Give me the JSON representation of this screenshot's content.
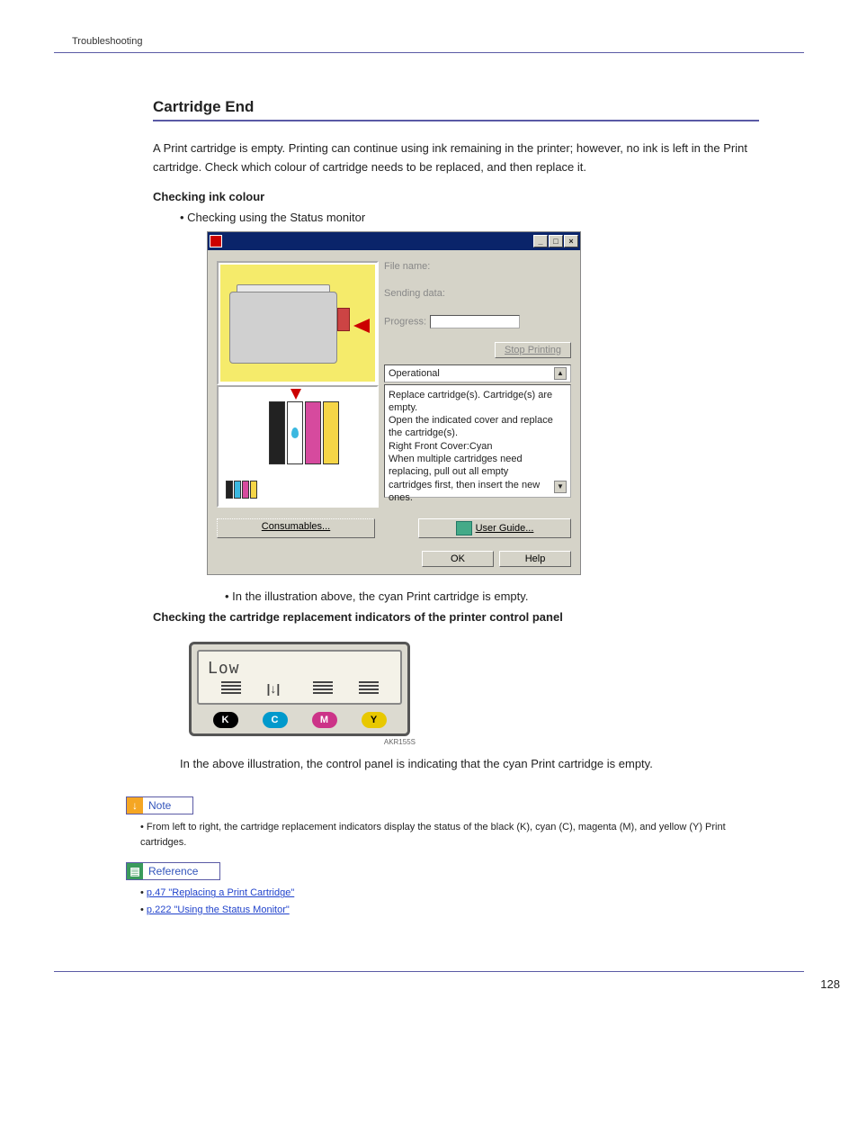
{
  "header": {
    "section": "Troubleshooting"
  },
  "title": "Cartridge End",
  "intro": "A Print cartridge is empty. Printing can continue using ink remaining in the printer; however, no ink is left in the Print cartridge. Check which colour of cartridge needs to be replaced, and then replace it.",
  "sub1": "Checking ink colour",
  "bullet1": "Checking using the Status monitor",
  "dialog": {
    "file_name_label": "File name:",
    "sending_label": "Sending data:",
    "progress_label": "Progress:",
    "stop_printing": "Stop Printing",
    "status": "Operational",
    "message": "Replace cartridge(s). Cartridge(s) are empty.\nOpen the indicated cover and replace the cartridge(s).\nRight Front Cover:Cyan\nWhen multiple cartridges need replacing, pull out all empty cartridges first, then insert the new ones.",
    "consumables": "Consumables...",
    "user_guide": "User Guide...",
    "ok": "OK",
    "help": "Help"
  },
  "caption1": "In the illustration above, the cyan Print cartridge is empty.",
  "sub2": "Checking the cartridge replacement indicators of the printer control panel",
  "panel": {
    "low": "Low",
    "k": "K",
    "c": "C",
    "m": "M",
    "y": "Y",
    "code": "AKR155S"
  },
  "caption2": "In the above illustration, the control panel is indicating that the cyan Print cartridge is empty.",
  "note_label": "Note",
  "note_text": "From left to right, the cartridge replacement indicators display the status of the black (K), cyan (C), magenta (M), and yellow (Y) Print cartridges.",
  "ref_label": "Reference",
  "ref1": "p.47 \"Replacing a Print Cartridge\"",
  "ref2": "p.222 \"Using the Status Monitor\"",
  "page_number": "128"
}
